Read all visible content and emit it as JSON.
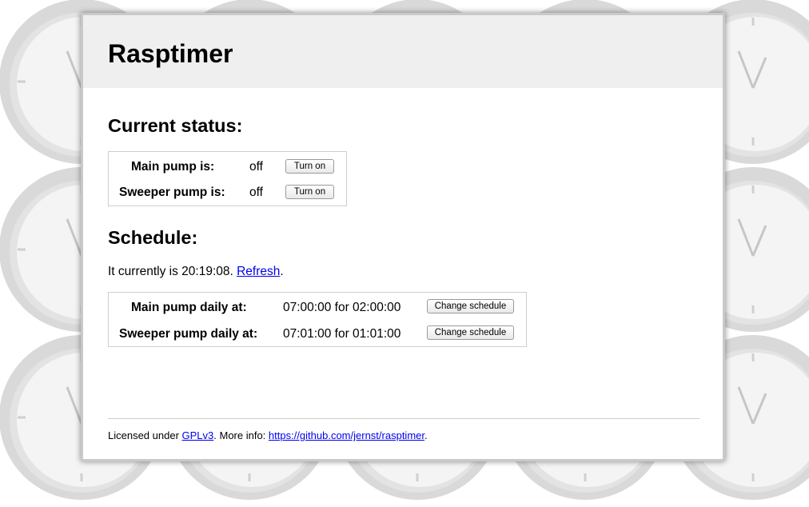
{
  "header": {
    "title": "Rasptimer"
  },
  "status": {
    "heading": "Current status:",
    "rows": [
      {
        "label": "Main pump is:",
        "value": "off",
        "button": "Turn on"
      },
      {
        "label": "Sweeper pump is:",
        "value": "off",
        "button": "Turn on"
      }
    ]
  },
  "schedule": {
    "heading": "Schedule:",
    "current_prefix": "It currently is 20:19:08. ",
    "refresh_label": "Refresh",
    "current_suffix": ".",
    "rows": [
      {
        "label": "Main pump daily at:",
        "value": "07:00:00 for 02:00:00",
        "button": "Change schedule"
      },
      {
        "label": "Sweeper pump daily at:",
        "value": "07:01:00 for 01:01:00",
        "button": "Change schedule"
      }
    ]
  },
  "footer": {
    "prefix": "Licensed under ",
    "license_link": "GPLv3",
    "middle": ". More info: ",
    "repo_link": "https://github.com/jernst/rasptimer",
    "suffix": "."
  },
  "colors": {
    "link": "#0000ee",
    "header_bg": "#efefef",
    "clock_face": "#f4f4f4"
  },
  "icons": {
    "background_pattern": "clock-icon"
  }
}
